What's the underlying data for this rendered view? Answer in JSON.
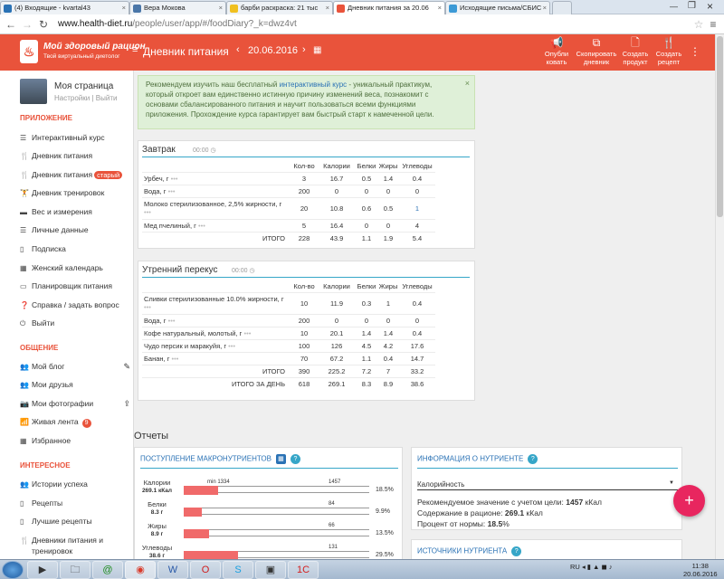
{
  "browser": {
    "tabs": [
      {
        "title": "(4) Входящие - kvartal43",
        "active": false
      },
      {
        "title": "Вера Мокова",
        "active": false
      },
      {
        "title": "барби раскраска: 21 тыс",
        "active": false
      },
      {
        "title": "Дневник питания за 20.06",
        "active": true
      },
      {
        "title": "Исходящие письма/СБИС",
        "active": false
      }
    ],
    "url_host": "www.health-diet.ru",
    "url_path": "/people/user/app/#/foodDiary?_k=dwz4vt"
  },
  "header": {
    "logo_title": "Мой здоровый рацион",
    "logo_sub": "Твой виртуальный диетолог",
    "diary_title": "Дневник питания",
    "date": "20.06.2016",
    "actions": [
      {
        "line1": "Опубли",
        "line2": "ковать"
      },
      {
        "line1": "Скопировать",
        "line2": "дневник"
      },
      {
        "line1": "Создать",
        "line2": "продукт"
      },
      {
        "line1": "Создать",
        "line2": "рецепт"
      }
    ]
  },
  "sidebar": {
    "profile_name": "Моя страница",
    "settings": "Настройки",
    "separator": "|",
    "logout": "Выйти",
    "section_app": "ПРИЛОЖЕНИЕ",
    "app_items": [
      "Интерактивный курс",
      "Дневник питания",
      "Дневник питания",
      "Дневник тренировок",
      "Вес и измерения",
      "Личные данные",
      "Подписка",
      "Женский календарь",
      "Планировщик питания",
      "Справка / задать вопрос",
      "Выйти"
    ],
    "old_badge": "старый",
    "section_social": "ОБЩЕНИЕ",
    "social_items": [
      "Мой блог",
      "Мои друзья",
      "Мои фотографии",
      "Живая лента",
      "Избранное"
    ],
    "feed_count": "9",
    "section_interesting": "ИНТЕРЕСНОЕ",
    "interesting_items": [
      "Истории успеха",
      "Рецепты",
      "Лучшие рецепты",
      "Дневники питания и",
      "тренировок"
    ]
  },
  "notice": {
    "part1": "Рекомендуем изучить наш бесплатный ",
    "link": "интерактивный курс",
    "part2": " - уникальный практикум, который откроет вам единственно истинную причину изменений веса, познакомит с основами сбалансированного питания и научит пользоваться всеми функциями приложения. Прохождение курса гарантирует вам быстрый старт к намеченной цели.",
    "close": "×"
  },
  "columns": [
    "Кол-во",
    "Калории",
    "Белки",
    "Жиры",
    "Углеводы"
  ],
  "breakfast": {
    "title": "Завтрак",
    "time": "00:00",
    "rows": [
      {
        "name": "Урбеч, г",
        "qty": "3",
        "kcal": "16.7",
        "prot": "0.5",
        "fat": "1.4",
        "carb": "0.4"
      },
      {
        "name": "Вода, г",
        "qty": "200",
        "kcal": "0",
        "prot": "0",
        "fat": "0",
        "carb": "0"
      },
      {
        "name": "Молоко стерилизованное, 2,5% жирности, г",
        "qty": "20",
        "kcal": "10.8",
        "prot": "0.6",
        "fat": "0.5",
        "carb": "1"
      },
      {
        "name": "Мед пчелиный, г",
        "qty": "5",
        "kcal": "16.4",
        "prot": "0",
        "fat": "0",
        "carb": "4"
      }
    ],
    "total_label": "ИТОГО",
    "total": {
      "qty": "228",
      "kcal": "43.9",
      "prot": "1.1",
      "fat": "1.9",
      "carb": "5.4"
    }
  },
  "snack": {
    "title": "Утренний перекус",
    "time": "00:00",
    "rows": [
      {
        "name": "Сливки стерилизованные 10.0% жирности, г",
        "qty": "10",
        "kcal": "11.9",
        "prot": "0.3",
        "fat": "1",
        "carb": "0.4"
      },
      {
        "name": "Вода, г",
        "qty": "200",
        "kcal": "0",
        "prot": "0",
        "fat": "0",
        "carb": "0"
      },
      {
        "name": "Кофе натуральный, молотый, г",
        "qty": "10",
        "kcal": "20.1",
        "prot": "1.4",
        "fat": "1.4",
        "carb": "0.4"
      },
      {
        "name": "Чудо персик и маракуйя, г",
        "qty": "100",
        "kcal": "126",
        "prot": "4.5",
        "fat": "4.2",
        "carb": "17.6"
      },
      {
        "name": "Банан, г",
        "qty": "70",
        "kcal": "67.2",
        "prot": "1.1",
        "fat": "0.4",
        "carb": "14.7"
      }
    ],
    "total_label": "ИТОГО",
    "total": {
      "qty": "390",
      "kcal": "225.2",
      "prot": "7.2",
      "fat": "7",
      "carb": "33.2"
    },
    "day_label": "ИТОГО ЗА ДЕНЬ",
    "day": {
      "qty": "618",
      "kcal": "269.1",
      "prot": "8.3",
      "fat": "8.9",
      "carb": "38.6"
    }
  },
  "reports": {
    "title": "Отчеты",
    "macro_title": "ПОСТУПЛЕНИЕ МАКРОНУТРИЕНТОВ",
    "macros": [
      {
        "name": "Калории",
        "value": "269.1 кКал",
        "min": "min 1334",
        "max": "1457",
        "pct": "18.5%",
        "fill": 0.185
      },
      {
        "name": "Белки",
        "value": "8.3 г",
        "min": "",
        "max": "84",
        "pct": "9.9%",
        "fill": 0.099
      },
      {
        "name": "Жиры",
        "value": "8.9 г",
        "min": "",
        "max": "66",
        "pct": "13.5%",
        "fill": 0.135
      },
      {
        "name": "Углеводы",
        "value": "38.6 г",
        "min": "",
        "max": "131",
        "pct": "29.5%",
        "fill": 0.295
      }
    ],
    "info_title": "ИНФОРМАЦИЯ О НУТРИЕНТЕ",
    "nutrient_select": "Калорийность",
    "rec_label": "Рекомендуемое значение с учетом цели:",
    "rec_value": "1457",
    "rec_unit": "кКал",
    "content_label": "Содержание в рационе:",
    "content_value": "269.1",
    "content_unit": "кКал",
    "pct_label": "Процент от нормы:",
    "pct_value": "18.5",
    "pct_unit": "%",
    "sources_title": "ИСТОЧНИКИ НУТРИЕНТА"
  },
  "fab": "+",
  "taskbar": {
    "lang": "RU",
    "time": "11:38",
    "date": "20.06.2016"
  }
}
